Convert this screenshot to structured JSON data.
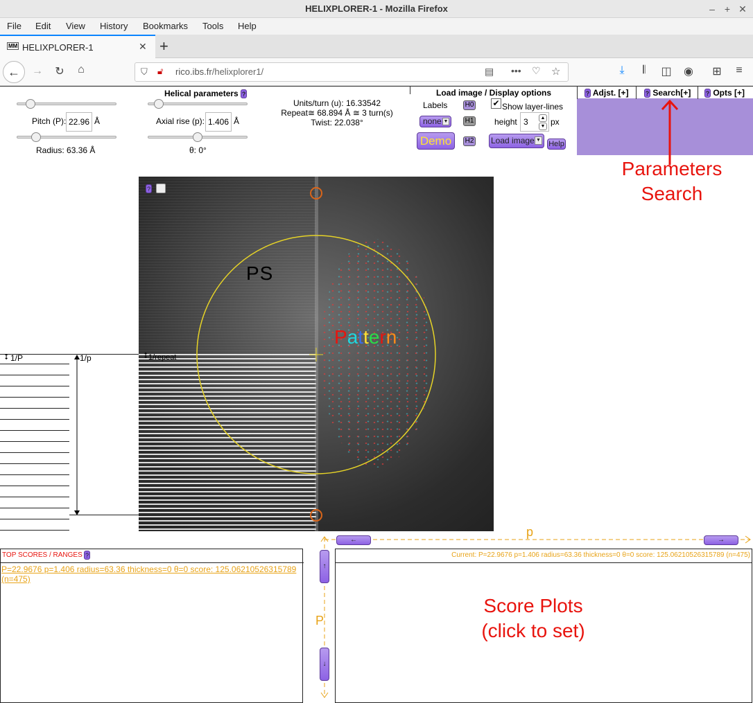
{
  "browser": {
    "window_title": "HELIXPLORER-1 - Mozilla Firefox",
    "menu": [
      "File",
      "Edit",
      "View",
      "History",
      "Bookmarks",
      "Tools",
      "Help"
    ],
    "tab_title": "HELIXPLORER-1",
    "favicon_text": "MM",
    "url_domain": "rico.ibs.fr",
    "url_path": "/helixplorer1/",
    "accent": "#0a84ff"
  },
  "controls": {
    "pitch_label": "Pitch (P):",
    "pitch_value": "22.96",
    "angstrom": "Å",
    "radius_label": "Radius: 63.36 Å",
    "helical_title": "Helical parameters",
    "axial_label": "Axial rise (p):",
    "axial_value": "1.406",
    "theta_label": "θ: 0°",
    "units_line": "Units/turn (u): 16.33542",
    "repeat_line": "Repeat≅ 68.894 Å ≅ 3 turn(s)",
    "twist_line": "Twist: 22.038°",
    "load_title": "Load image / Display options",
    "labels_label": "Labels",
    "labels_select": "none",
    "h0": "H0",
    "h1": "H1",
    "h2": "H2",
    "show_layer_lines": "Show layer-lines",
    "height_label": "height",
    "height_value": "3",
    "px": "px",
    "demo_label": "Demo",
    "load_image_label": "Load image",
    "help_label": "Help",
    "tab_adjst": "Adjst. [+]",
    "tab_search": "Search[+]",
    "tab_opts": "Opts [+]",
    "q": "?",
    "purple": "#a78fd9"
  },
  "canvas": {
    "ps_label": "PS",
    "pattern_letters": [
      "P",
      "a",
      "t",
      "t",
      "e",
      "r",
      "n"
    ],
    "pattern_colors": [
      "#e8140e",
      "#1fd8e0",
      "#3a6ee8",
      "#ffe233",
      "#2bdc48",
      "#e8140e",
      "#ff8a1a"
    ],
    "repeat_label": "1/repeat",
    "left_label_P": "1/P",
    "left_label_p": "1/p"
  },
  "annotations": {
    "params_search_1": "Parameters",
    "params_search_2": "Search",
    "score_plots_1": "Score Plots",
    "score_plots_2": "(click to set)"
  },
  "scores": {
    "title": "TOP SCORES / RANGES",
    "entry": "P=22.9676 p=1.406 radius=63.36 thickness=0 θ=0 score: 125.06210526315789 (n=475)",
    "current": "Current: P=22.9676 p=1.406 radius=63.36 thickness=0 θ=0 score: 125.06210526315789 (n=475)",
    "axis_p": "p",
    "axis_P": "P",
    "left_arrow": "←",
    "right_arrow": "→",
    "up_arrow": "↑",
    "down_arrow": "↓",
    "orange": "#e8a317"
  }
}
